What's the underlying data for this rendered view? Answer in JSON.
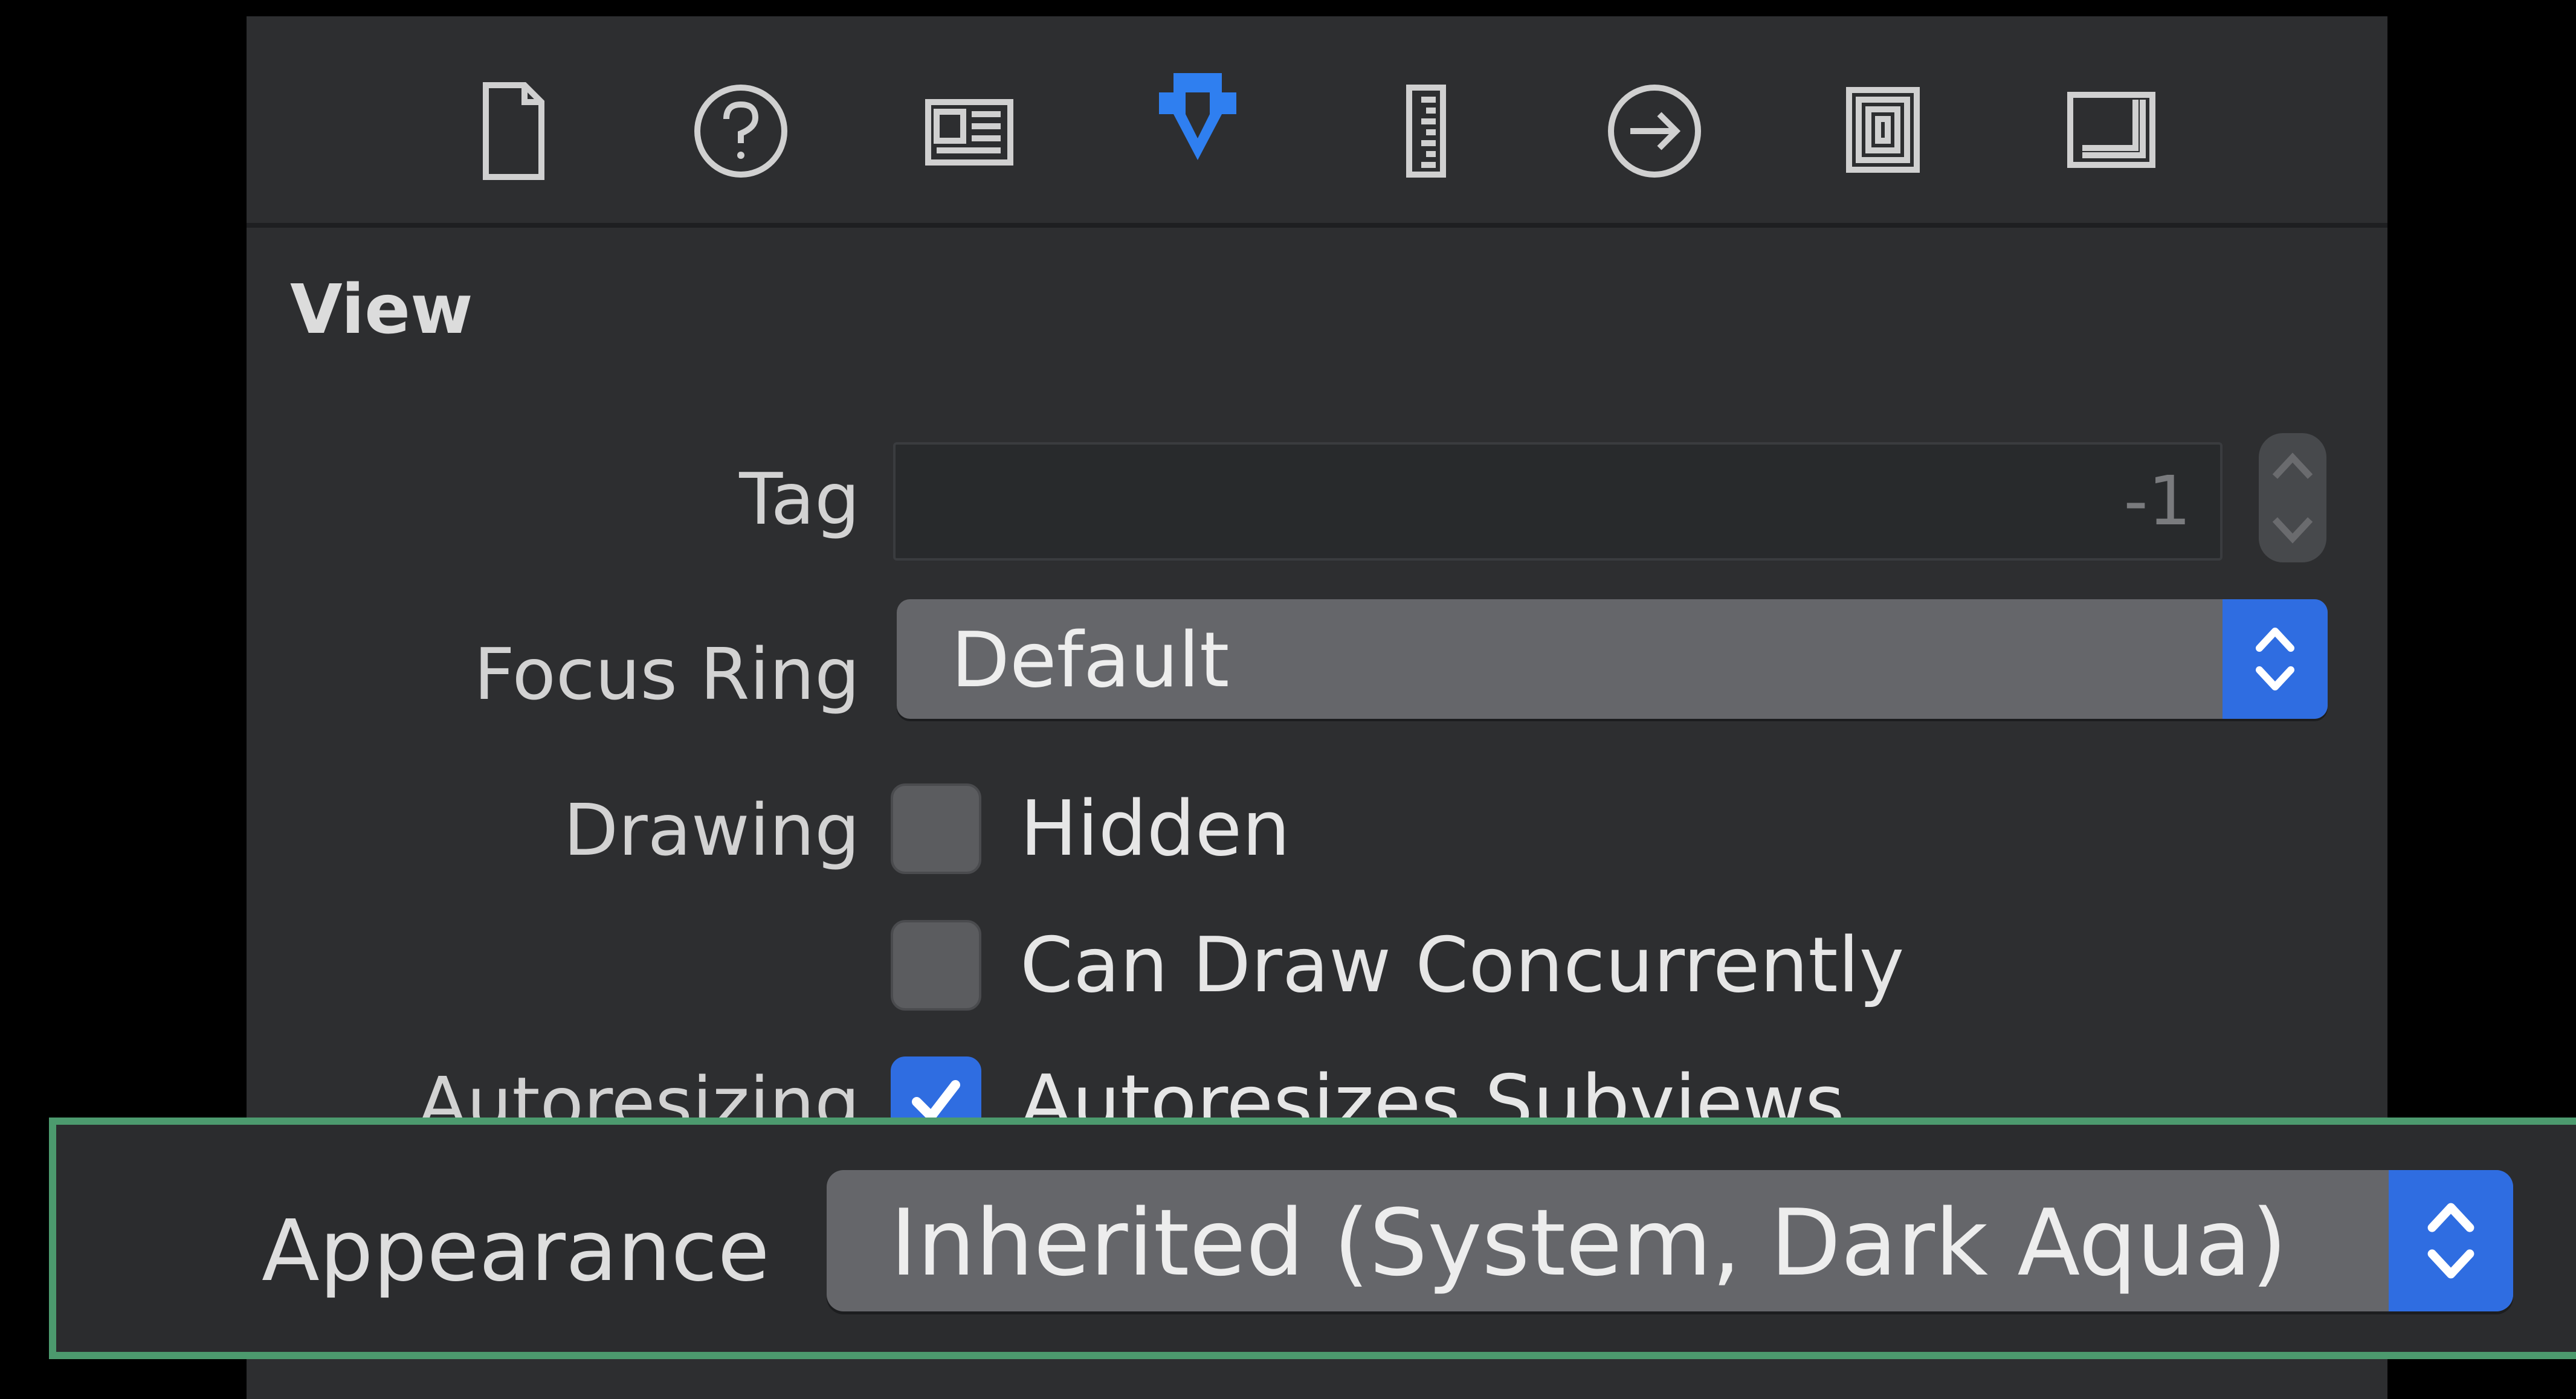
{
  "toolbar": {
    "icons": [
      {
        "name": "file-icon",
        "selected": false
      },
      {
        "name": "help-icon",
        "selected": false
      },
      {
        "name": "identity-icon",
        "selected": false
      },
      {
        "name": "attributes-icon",
        "selected": true
      },
      {
        "name": "size-ruler-icon",
        "selected": false
      },
      {
        "name": "connections-icon",
        "selected": false
      },
      {
        "name": "bindings-icon",
        "selected": false
      },
      {
        "name": "view-effects-icon",
        "selected": false
      }
    ],
    "selected_color": "#2f7ff0",
    "icon_color": "#d0d0d0"
  },
  "section": {
    "title": "View"
  },
  "tag": {
    "label": "Tag",
    "value": "-1"
  },
  "focus_ring": {
    "label": "Focus Ring",
    "value": "Default"
  },
  "drawing": {
    "label": "Drawing",
    "hidden_label": "Hidden",
    "hidden_checked": false,
    "concurrent_label": "Can Draw Concurrently",
    "concurrent_checked": false
  },
  "autoresizing": {
    "label": "Autoresizing",
    "option_label": "Autoresizes Subviews",
    "checked": true
  },
  "appearance": {
    "label": "Appearance",
    "value": "Inherited (System, Dark Aqua)"
  },
  "colors": {
    "accent": "#2f6de1",
    "highlight_border": "#4c9a6e",
    "panel_bg": "#2d2e30"
  }
}
